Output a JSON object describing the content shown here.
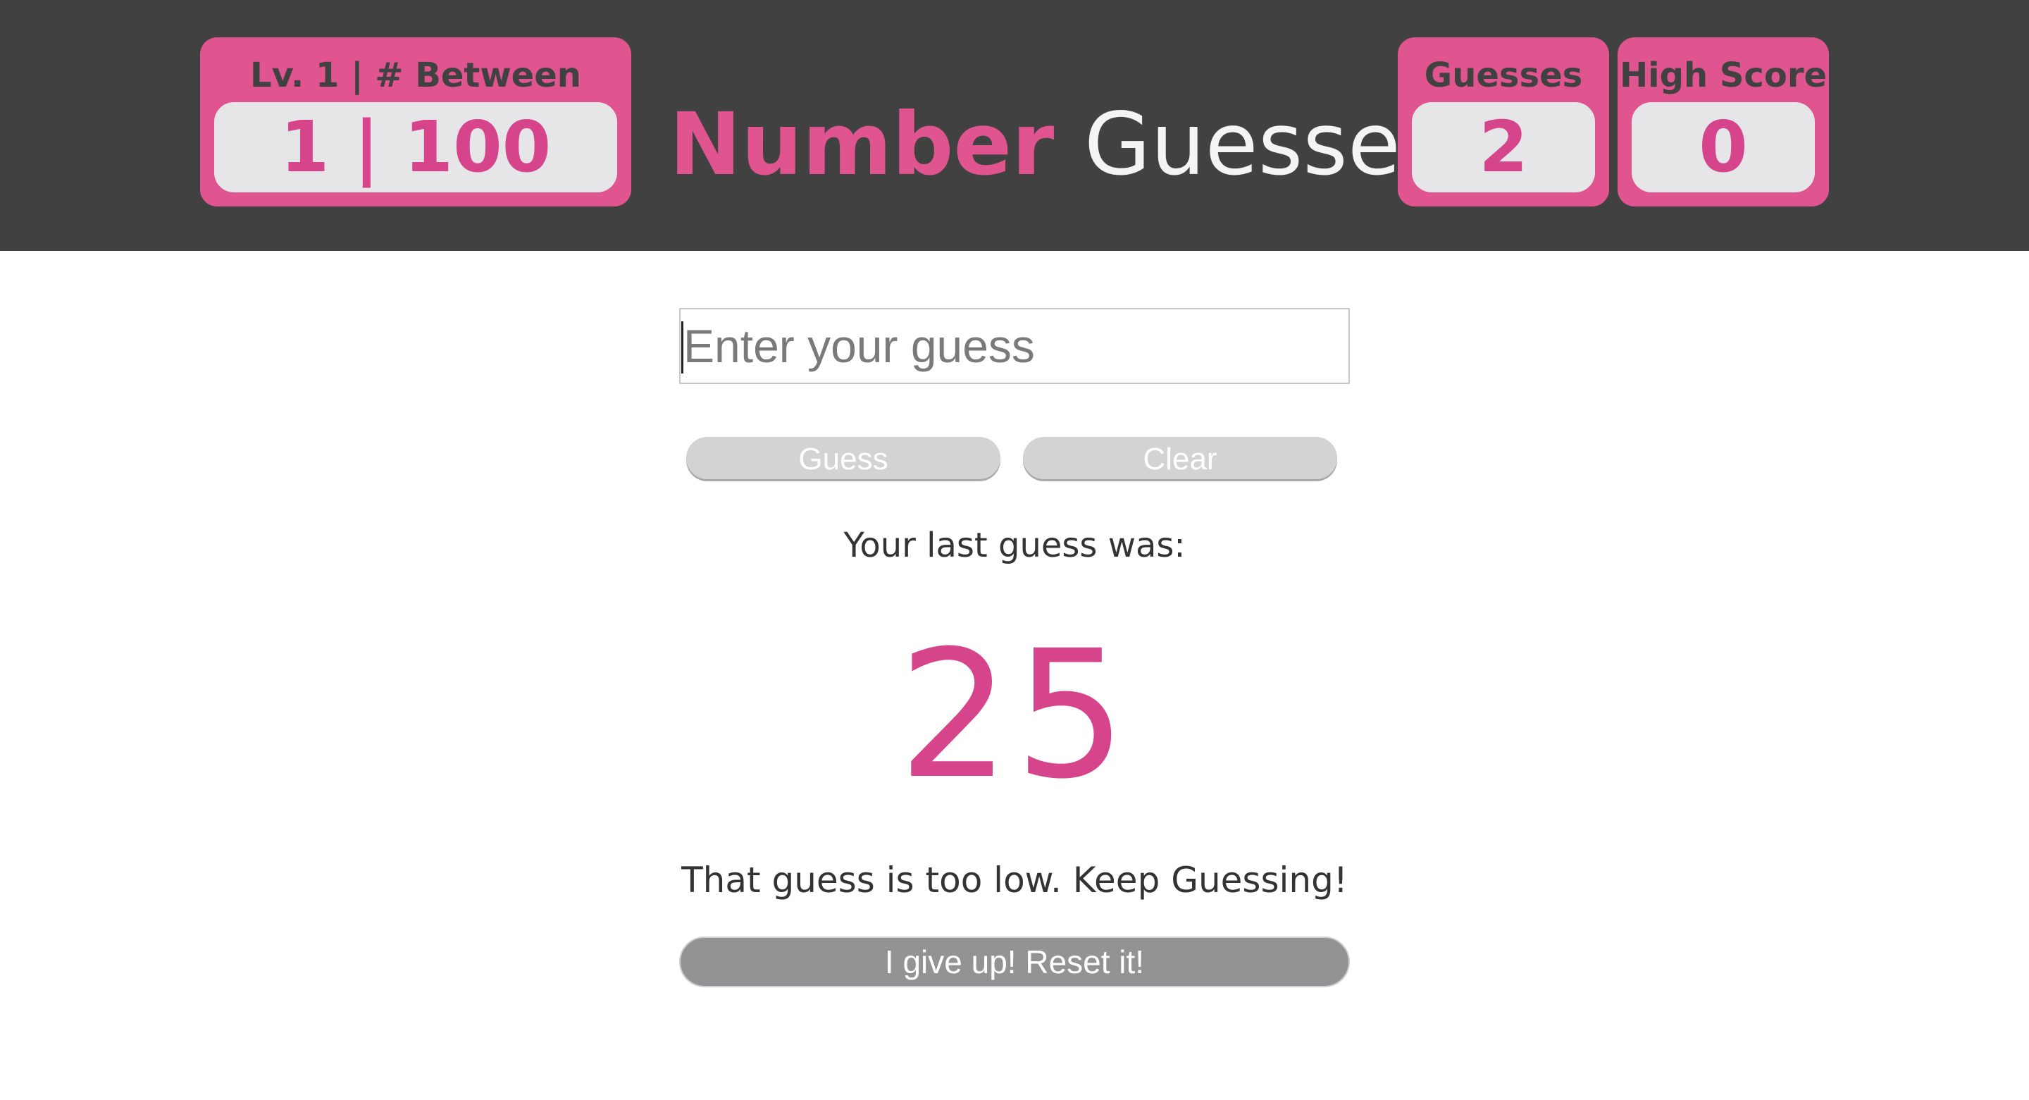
{
  "header": {
    "title_strong": "Number",
    "title_light": "Guesser",
    "level": {
      "label": "Lv. 1 | # Between",
      "value": "1 | 100"
    },
    "guesses": {
      "label": "Guesses",
      "value": "2"
    },
    "high_score": {
      "label": "High Score",
      "value": "0"
    }
  },
  "form": {
    "input_placeholder": "Enter your guess",
    "input_value": "",
    "guess_label": "Guess",
    "clear_label": "Clear"
  },
  "result": {
    "last_label": "Your last guess was:",
    "last_guess": "25",
    "feedback": "That guess is too low. Keep Guessing!"
  },
  "reset": {
    "label": "I give up! Reset it!"
  },
  "colors": {
    "header_bg": "#414141",
    "accent": "#e0558f",
    "number_pink": "#d6458b",
    "pill_bg": "#e6e6e8",
    "button_gray": "#d3d3d5",
    "reset_gray": "#939395"
  }
}
